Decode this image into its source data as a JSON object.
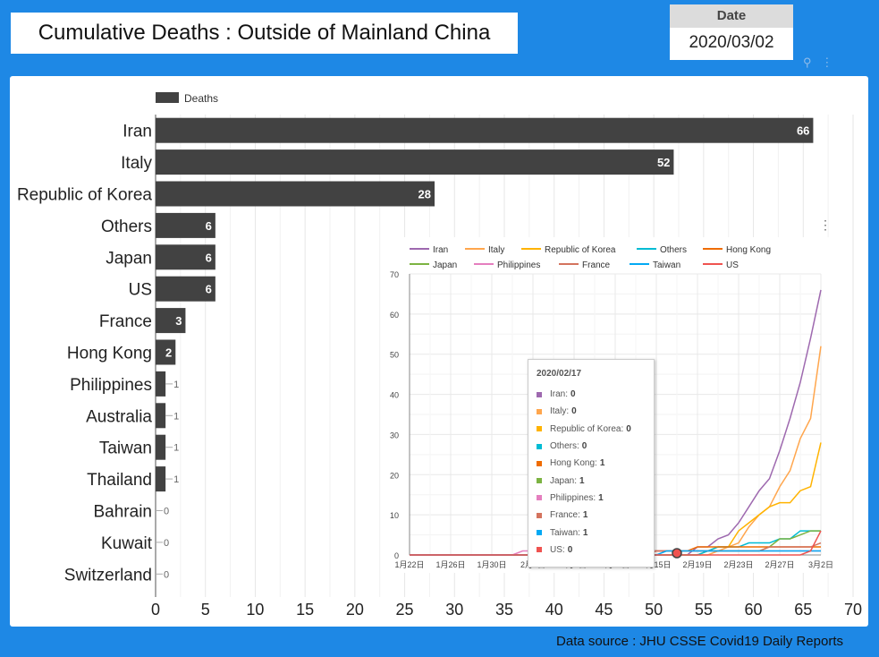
{
  "header": {
    "title": "Cumulative Deaths : Outside of Mainland China",
    "date_label": "Date",
    "date_value": "2020/03/02"
  },
  "footer": {
    "source": "Data source : JHU CSSE Covid19 Daily Reports"
  },
  "chart_data": [
    {
      "type": "bar",
      "orientation": "horizontal",
      "legend": "top-left",
      "series": [
        {
          "name": "Deaths",
          "color": "#424242"
        }
      ],
      "categories": [
        "Iran",
        "Italy",
        "Republic of Korea",
        "Others",
        "Japan",
        "US",
        "France",
        "Hong Kong",
        "Philippines",
        "Australia",
        "Taiwan",
        "Thailand",
        "Bahrain",
        "Kuwait",
        "Switzerland"
      ],
      "values": [
        66,
        52,
        28,
        6,
        6,
        6,
        3,
        2,
        1,
        1,
        1,
        1,
        0,
        0,
        0
      ],
      "xlim": [
        0,
        70
      ],
      "xticks": [
        0,
        5,
        10,
        15,
        20,
        25,
        30,
        35,
        40,
        45,
        50,
        55,
        60,
        65,
        70
      ],
      "grid": true
    },
    {
      "type": "line",
      "legend": "top",
      "ylim": [
        0,
        70
      ],
      "yticks": [
        0,
        10,
        20,
        30,
        40,
        50,
        60,
        70
      ],
      "xtick_labels": [
        "1月22日",
        "1月26日",
        "1月30日",
        "2月3日",
        "2月7日",
        "2月11日",
        "2月15日",
        "2月19日",
        "2月23日",
        "2月27日",
        "3月2日"
      ],
      "x_range": [
        "2020/01/22",
        "2020/03/02"
      ],
      "grid": true,
      "series": [
        {
          "name": "Iran",
          "color": "#9e69af",
          "values": [
            0,
            0,
            0,
            0,
            0,
            0,
            0,
            0,
            0,
            0,
            0,
            0,
            0,
            0,
            0,
            0,
            0,
            0,
            0,
            0,
            0,
            0,
            0,
            0,
            0,
            0,
            0,
            0,
            2,
            2,
            4,
            5,
            8,
            12,
            16,
            19,
            26,
            34,
            43,
            54,
            66
          ]
        },
        {
          "name": "Italy",
          "color": "#ffa64d",
          "values": [
            0,
            0,
            0,
            0,
            0,
            0,
            0,
            0,
            0,
            0,
            0,
            0,
            0,
            0,
            0,
            0,
            0,
            0,
            0,
            0,
            0,
            0,
            0,
            0,
            0,
            0,
            0,
            0,
            0,
            0,
            1,
            2,
            3,
            7,
            10,
            12,
            17,
            21,
            29,
            34,
            52
          ]
        },
        {
          "name": "Republic of Korea",
          "color": "#ffb300",
          "values": [
            0,
            0,
            0,
            0,
            0,
            0,
            0,
            0,
            0,
            0,
            0,
            0,
            0,
            0,
            0,
            0,
            0,
            0,
            0,
            0,
            0,
            0,
            0,
            0,
            0,
            0,
            0,
            0,
            0,
            1,
            2,
            2,
            6,
            8,
            10,
            12,
            13,
            13,
            16,
            17,
            28
          ]
        },
        {
          "name": "Others",
          "color": "#00bcd4",
          "values": [
            0,
            0,
            0,
            0,
            0,
            0,
            0,
            0,
            0,
            0,
            0,
            0,
            0,
            0,
            0,
            0,
            0,
            0,
            0,
            0,
            0,
            0,
            0,
            0,
            0,
            0,
            0,
            0,
            0,
            1,
            2,
            2,
            2,
            3,
            3,
            3,
            4,
            4,
            6,
            6,
            6
          ]
        },
        {
          "name": "Hong Kong",
          "color": "#ef6c00",
          "values": [
            0,
            0,
            0,
            0,
            0,
            0,
            0,
            0,
            0,
            0,
            0,
            0,
            0,
            0,
            1,
            1,
            1,
            1,
            1,
            1,
            1,
            1,
            1,
            1,
            1,
            1,
            1,
            1,
            2,
            2,
            2,
            2,
            2,
            2,
            2,
            2,
            2,
            2,
            2,
            2,
            2
          ]
        },
        {
          "name": "Japan",
          "color": "#7cb342",
          "values": [
            0,
            0,
            0,
            0,
            0,
            0,
            0,
            0,
            0,
            0,
            0,
            0,
            0,
            0,
            0,
            0,
            0,
            0,
            0,
            0,
            0,
            0,
            1,
            1,
            1,
            1,
            1,
            1,
            1,
            1,
            1,
            1,
            1,
            1,
            1,
            2,
            4,
            4,
            5,
            6,
            6
          ]
        },
        {
          "name": "Philippines",
          "color": "#e57fbf",
          "values": [
            0,
            0,
            0,
            0,
            0,
            0,
            0,
            0,
            0,
            0,
            0,
            1,
            1,
            1,
            1,
            1,
            1,
            1,
            1,
            1,
            1,
            1,
            1,
            1,
            1,
            1,
            1,
            1,
            1,
            1,
            1,
            1,
            1,
            1,
            1,
            1,
            1,
            1,
            1,
            1,
            1
          ]
        },
        {
          "name": "France",
          "color": "#d4735e",
          "values": [
            0,
            0,
            0,
            0,
            0,
            0,
            0,
            0,
            0,
            0,
            0,
            0,
            0,
            0,
            0,
            0,
            0,
            0,
            0,
            0,
            0,
            0,
            0,
            0,
            1,
            1,
            1,
            1,
            1,
            1,
            1,
            1,
            1,
            1,
            1,
            2,
            2,
            2,
            2,
            2,
            3
          ]
        },
        {
          "name": "Taiwan",
          "color": "#03a9f4",
          "values": [
            0,
            0,
            0,
            0,
            0,
            0,
            0,
            0,
            0,
            0,
            0,
            0,
            0,
            0,
            0,
            0,
            0,
            0,
            0,
            0,
            0,
            0,
            0,
            0,
            0,
            1,
            1,
            1,
            1,
            1,
            1,
            1,
            1,
            1,
            1,
            1,
            1,
            1,
            1,
            1,
            1
          ]
        },
        {
          "name": "US",
          "color": "#ef5350",
          "values": [
            0,
            0,
            0,
            0,
            0,
            0,
            0,
            0,
            0,
            0,
            0,
            0,
            0,
            0,
            0,
            0,
            0,
            0,
            0,
            0,
            0,
            0,
            0,
            0,
            0,
            0,
            0,
            0,
            0,
            0,
            0,
            0,
            0,
            0,
            0,
            0,
            0,
            0,
            0,
            1,
            6
          ]
        }
      ],
      "tooltip": {
        "date": "2020/02/17",
        "rows": [
          {
            "name": "Iran",
            "value": "0",
            "color": "#9e69af"
          },
          {
            "name": "Italy",
            "value": "0",
            "color": "#ffa64d"
          },
          {
            "name": "Republic of Korea",
            "value": "0",
            "color": "#ffb300"
          },
          {
            "name": "Others",
            "value": "0",
            "color": "#00bcd4"
          },
          {
            "name": "Hong Kong",
            "value": "1",
            "color": "#ef6c00"
          },
          {
            "name": "Japan",
            "value": "1",
            "color": "#7cb342"
          },
          {
            "name": "Philippines",
            "value": "1",
            "color": "#e57fbf"
          },
          {
            "name": "France",
            "value": "1",
            "color": "#d4735e"
          },
          {
            "name": "Taiwan",
            "value": "1",
            "color": "#03a9f4"
          },
          {
            "name": "US",
            "value": "0",
            "color": "#ef5350"
          }
        ]
      }
    }
  ]
}
